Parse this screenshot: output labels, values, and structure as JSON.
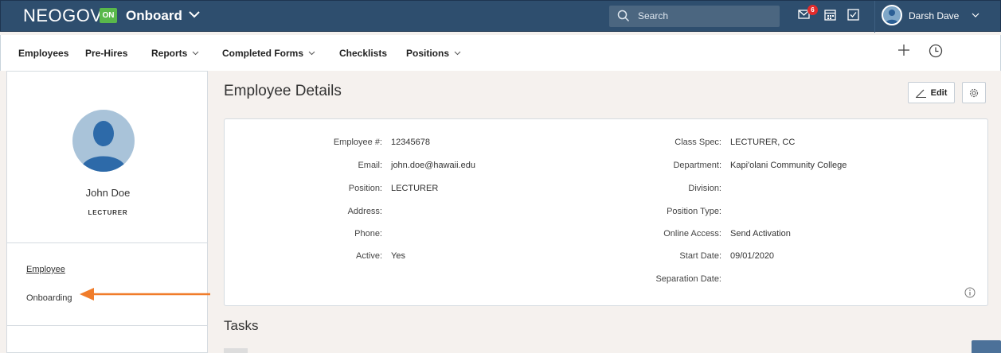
{
  "topbar": {
    "brand": "NEOGOV",
    "app_badge": "ON",
    "app_name": "Onboard",
    "search_placeholder": "Search",
    "mail_badge_count": "6",
    "user_name": "Darsh Dave",
    "color": "#2e4e6e"
  },
  "nav": {
    "items": [
      {
        "label": "Employees",
        "dropdown": false
      },
      {
        "label": "Pre-Hires",
        "dropdown": false
      },
      {
        "label": "Reports",
        "dropdown": true
      },
      {
        "label": "Completed Forms",
        "dropdown": true
      },
      {
        "label": "Checklists",
        "dropdown": false
      },
      {
        "label": "Positions",
        "dropdown": true
      }
    ]
  },
  "sidebar": {
    "employee_name": "John Doe",
    "employee_title": "LECTURER",
    "links": [
      {
        "label": "Employee",
        "active": true
      },
      {
        "label": "Onboarding",
        "active": false
      }
    ]
  },
  "main": {
    "page_title": "Employee Details",
    "edit_label": "Edit",
    "left_fields": [
      {
        "label": "Employee #:",
        "value": "12345678"
      },
      {
        "label": "Email:",
        "value": "john.doe@hawaii.edu"
      },
      {
        "label": "Position:",
        "value": "LECTURER"
      },
      {
        "label": "Address:",
        "value": ""
      },
      {
        "label": "Phone:",
        "value": ""
      },
      {
        "label": "Active:",
        "value": "Yes"
      }
    ],
    "right_fields": [
      {
        "label": "Class Spec:",
        "value": "LECTURER, CC"
      },
      {
        "label": "Department:",
        "value": "Kapi'olani Community College"
      },
      {
        "label": "Division:",
        "value": ""
      },
      {
        "label": "Position Type:",
        "value": ""
      },
      {
        "label": "Online Access:",
        "value": "Send Activation"
      },
      {
        "label": "Start Date:",
        "value": "09/01/2020"
      },
      {
        "label": "Separation Date:",
        "value": ""
      }
    ],
    "tasks_title": "Tasks"
  },
  "annotation": {
    "arrow_color": "#f07c2a"
  }
}
